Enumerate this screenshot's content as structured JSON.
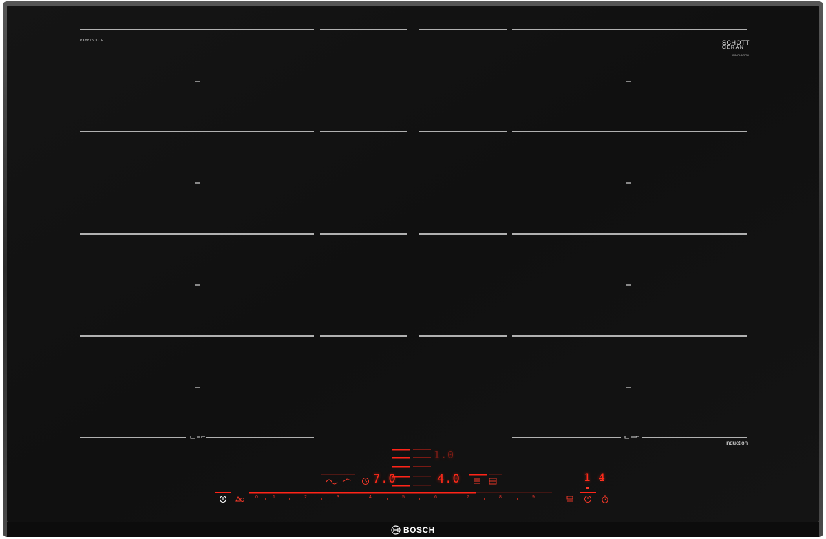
{
  "product": {
    "model_code": "PXY875DC1E",
    "glass_brand_line1": "SCHOTT",
    "glass_brand_line2": "CERAN",
    "glass_brand_code": "INNOVATION",
    "induction_label": "induction",
    "manufacturer": "BOSCH"
  },
  "display": {
    "top_readout": "1.0",
    "left_readout": "7.0",
    "center_readout": "4.0",
    "right_readout": "1 4"
  },
  "power_scale": [
    "0",
    "1",
    "2",
    "3",
    "4",
    "5",
    "6",
    "7",
    "8",
    "9"
  ],
  "icons": {
    "power": "power-icon",
    "child_lock": "child-lock-icon",
    "boost": "boost-icon",
    "keep_warm": "keep-warm-icon",
    "cooking_timer": "cooking-timer-icon",
    "menu": "menu-icon",
    "flex_zone": "flex-zone-icon",
    "wipe_protection": "wipe-protection-icon",
    "timer": "timer-icon",
    "stopwatch": "stopwatch-icon",
    "bosch_logo": "bosch-logo-icon"
  },
  "colors": {
    "glass": "#111111",
    "frame": "#3a3a3a",
    "zone_lines": "#e6e6e6",
    "display_red": "#ff2a1a"
  }
}
